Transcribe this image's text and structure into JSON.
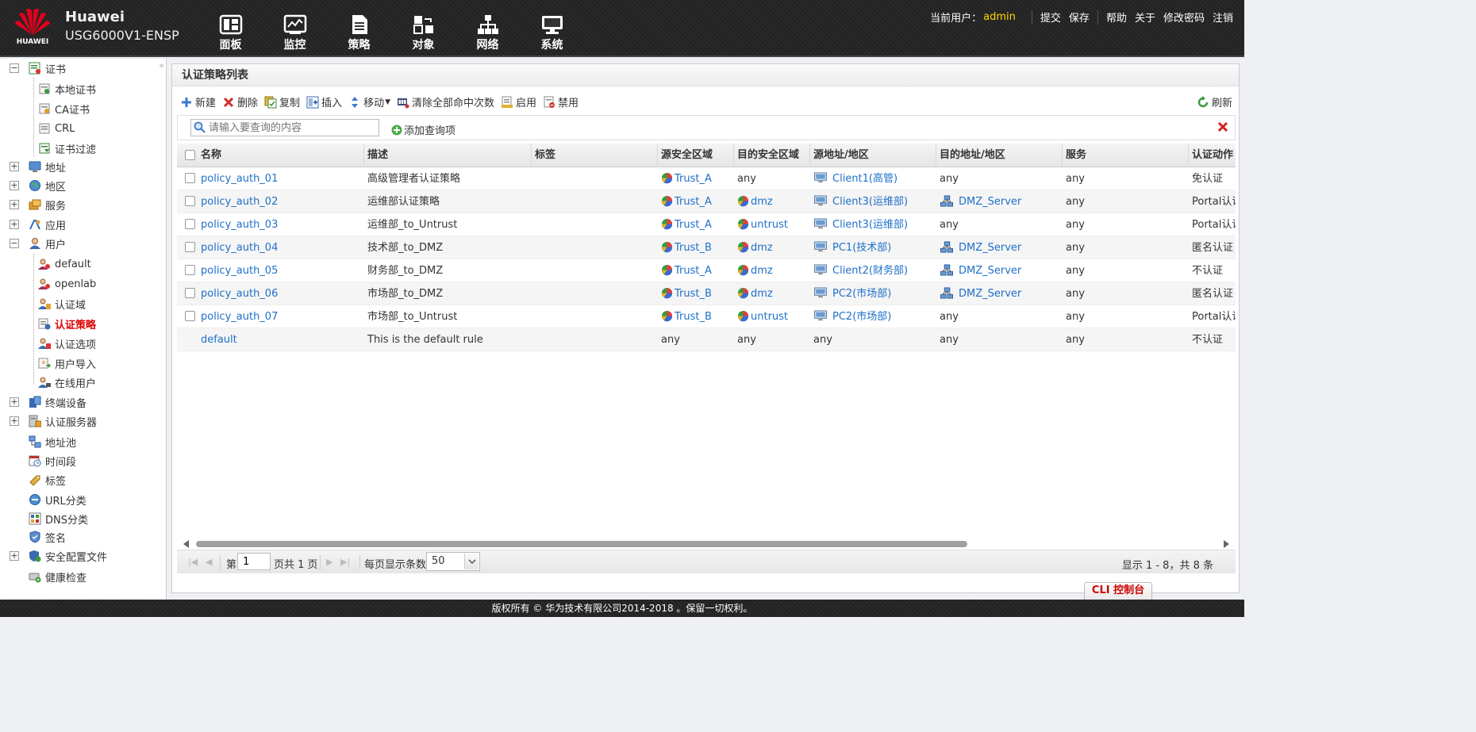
{
  "header": {
    "logo_text": "HUAWEI",
    "brand_name": "Huawei",
    "model": "USG6000V1-ENSP",
    "nav": [
      {
        "label": "面板",
        "icon": "dashboard-icon"
      },
      {
        "label": "监控",
        "icon": "monitor-icon"
      },
      {
        "label": "策略",
        "icon": "policy-icon"
      },
      {
        "label": "对象",
        "icon": "object-icon"
      },
      {
        "label": "网络",
        "icon": "network-icon"
      },
      {
        "label": "系统",
        "icon": "system-icon"
      }
    ],
    "current_user_label": "当前用户：",
    "current_user": "admin",
    "links": [
      "提交",
      "保存",
      "帮助",
      "关于",
      "修改密码",
      "注销"
    ]
  },
  "sidebar": {
    "items": [
      {
        "label": "证书",
        "toggle": "−"
      },
      {
        "label": "本地证书"
      },
      {
        "label": "CA证书"
      },
      {
        "label": "CRL"
      },
      {
        "label": "证书过滤"
      },
      {
        "label": "地址",
        "toggle": "+"
      },
      {
        "label": "地区",
        "toggle": "+"
      },
      {
        "label": "服务",
        "toggle": "+"
      },
      {
        "label": "应用",
        "toggle": "+"
      },
      {
        "label": "用户",
        "toggle": "−"
      },
      {
        "label": "default"
      },
      {
        "label": "openlab"
      },
      {
        "label": "认证域"
      },
      {
        "label": "认证策略"
      },
      {
        "label": "认证选项"
      },
      {
        "label": "用户导入"
      },
      {
        "label": "在线用户"
      },
      {
        "label": "终端设备",
        "toggle": "+"
      },
      {
        "label": "认证服务器",
        "toggle": "+"
      },
      {
        "label": "地址池"
      },
      {
        "label": "时间段"
      },
      {
        "label": "标签"
      },
      {
        "label": "URL分类"
      },
      {
        "label": "DNS分类"
      },
      {
        "label": "签名"
      },
      {
        "label": "安全配置文件",
        "toggle": "+"
      },
      {
        "label": "健康检查"
      }
    ]
  },
  "main": {
    "title": "认证策略列表",
    "toolbar": {
      "new": "新建",
      "delete": "删除",
      "copy": "复制",
      "insert": "插入",
      "move": "移动",
      "clear_hits": "清除全部命中次数",
      "enable": "启用",
      "disable": "禁用",
      "refresh": "刷新"
    },
    "search": {
      "placeholder": "请输入要查询的内容",
      "add_condition": "添加查询项"
    },
    "columns": [
      "名称",
      "描述",
      "标签",
      "源安全区域",
      "目的安全区域",
      "源地址/地区",
      "目的地址/地区",
      "服务",
      "认证动作"
    ],
    "rows": [
      {
        "name": "policy_auth_01",
        "desc": "高级管理者认证策略",
        "tag": "",
        "src_zone": "Trust_A",
        "dst_zone": "any",
        "src_addr": "Client1(高管)",
        "dst_addr": "any",
        "service": "any",
        "action": "免认证"
      },
      {
        "name": "policy_auth_02",
        "desc": "运维部认证策略",
        "tag": "",
        "src_zone": "Trust_A",
        "dst_zone": "dmz",
        "src_addr": "Client3(运维部)",
        "dst_addr": "DMZ_Server",
        "service": "any",
        "action": "Portal认证"
      },
      {
        "name": "policy_auth_03",
        "desc": "运维部_to_Untrust",
        "tag": "",
        "src_zone": "Trust_A",
        "dst_zone": "untrust",
        "src_addr": "Client3(运维部)",
        "dst_addr": "any",
        "service": "any",
        "action": "Portal认证"
      },
      {
        "name": "policy_auth_04",
        "desc": "技术部_to_DMZ",
        "tag": "",
        "src_zone": "Trust_B",
        "dst_zone": "dmz",
        "src_addr": "PC1(技术部)",
        "dst_addr": "DMZ_Server",
        "service": "any",
        "action": "匿名认证"
      },
      {
        "name": "policy_auth_05",
        "desc": "财务部_to_DMZ",
        "tag": "",
        "src_zone": "Trust_A",
        "dst_zone": "dmz",
        "src_addr": "Client2(财务部)",
        "dst_addr": "DMZ_Server",
        "service": "any",
        "action": "不认证"
      },
      {
        "name": "policy_auth_06",
        "desc": "市场部_to_DMZ",
        "tag": "",
        "src_zone": "Trust_B",
        "dst_zone": "dmz",
        "src_addr": "PC2(市场部)",
        "dst_addr": "DMZ_Server",
        "service": "any",
        "action": "匿名认证"
      },
      {
        "name": "policy_auth_07",
        "desc": "市场部_to_Untrust",
        "tag": "",
        "src_zone": "Trust_B",
        "dst_zone": "untrust",
        "src_addr": "PC2(市场部)",
        "dst_addr": "any",
        "service": "any",
        "action": "Portal认证"
      },
      {
        "name": "default",
        "desc": "This is the default rule",
        "tag": "",
        "src_zone": "any",
        "dst_zone": "any",
        "src_addr": "any",
        "dst_addr": "any",
        "service": "any",
        "action": "不认证",
        "is_default": true
      }
    ],
    "pager": {
      "page_prefix": "第",
      "page": "1",
      "page_suffix": "页共 1 页",
      "per_page_label": "每页显示条数",
      "per_page": "50",
      "summary": "显示 1 - 8，共 8 条"
    }
  },
  "cli_button": "CLI 控制台",
  "footer": "版权所有 © 华为技术有限公司2014-2018 。保留一切权利。",
  "colors": {
    "link": "#1e6fc8",
    "active": "#dd0000",
    "user": "#ffd800",
    "brand_red": "#e3001b"
  }
}
